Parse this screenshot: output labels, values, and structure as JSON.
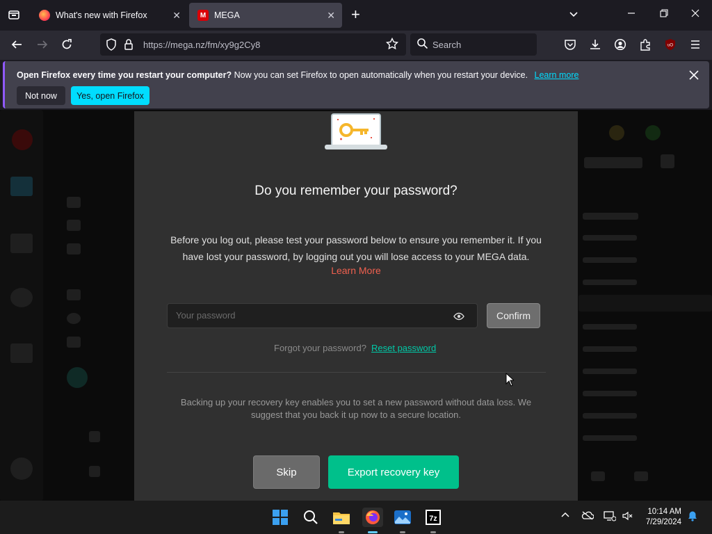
{
  "browser": {
    "tabs": [
      {
        "title": "What's new with Firefox",
        "active": false
      },
      {
        "title": "MEGA",
        "active": true
      }
    ],
    "url": "https://mega.nz/fm/xy9g2Cy8",
    "search_placeholder": "Search",
    "new_tab_symbol": "+"
  },
  "notification": {
    "bold": "Open Firefox every time you restart your computer?",
    "text": "Now you can set Firefox to open automatically when you restart your device.",
    "link": "Learn more",
    "not_now": "Not now",
    "yes": "Yes, open Firefox"
  },
  "dialog": {
    "title": "Do you remember your password?",
    "description": "Before you log out, please test your password below to ensure you remember it. If you have lost your password, by logging out you will lose access to your MEGA data.",
    "learn_more": "Learn More",
    "password_placeholder": "Your password",
    "confirm": "Confirm",
    "forgot": "Forgot your password?",
    "reset": "Reset password",
    "backup_text": "Backing up your recovery key enables you to set a new password without data loss. We suggest that you back it up now to a secure location.",
    "skip": "Skip",
    "export": "Export recovery key"
  },
  "taskbar": {
    "time": "10:14 AM",
    "date": "7/29/2024"
  },
  "colors": {
    "accent_firefox": "#00ddff",
    "mega_red": "#d90007",
    "mega_green": "#00c08b",
    "learn_more_red": "#f0604f"
  }
}
